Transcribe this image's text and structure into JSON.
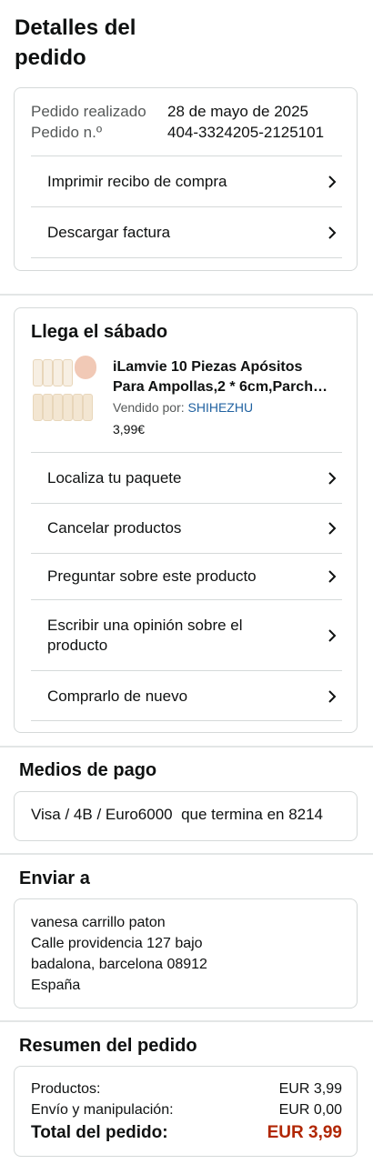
{
  "page": {
    "title": "Detalles del pedido"
  },
  "order": {
    "placed_label": "Pedido realizado",
    "placed_value": "28 de mayo de 2025",
    "number_label": "Pedido n.º",
    "number_value": "404-3324205-2125101",
    "actions": [
      {
        "label": "Imprimir recibo de compra"
      },
      {
        "label": "Descargar factura"
      }
    ]
  },
  "shipment": {
    "heading": "Llega el sábado",
    "product": {
      "title_line1": "iLamvie 10 Piezas Apósitos",
      "title_line2": "Para Ampollas,2 * 6cm,Parch…",
      "seller_label": "Vendido por:",
      "seller_name": "SHIHEZHU",
      "price": "3,99€"
    },
    "actions": [
      {
        "label": "Localiza tu paquete"
      },
      {
        "label": "Cancelar productos"
      },
      {
        "label": "Preguntar sobre este producto"
      },
      {
        "label_line1": "Escribir una opinión sobre el",
        "label_line2": "producto"
      },
      {
        "label": "Comprarlo de nuevo"
      }
    ]
  },
  "payment": {
    "heading": "Medios de pago",
    "method": "Visa / 4B / Euro6000  que termina en 8214"
  },
  "shipping": {
    "heading": "Enviar a",
    "lines": [
      "vanesa carrillo paton",
      "Calle providencia 127 bajo",
      "badalona, barcelona 08912",
      "España"
    ]
  },
  "summary": {
    "heading": "Resumen del pedido",
    "products_label": "Productos:",
    "products_value": "EUR 3,99",
    "shipping_label": "Envío y manipulación:",
    "shipping_value": "EUR 0,00",
    "total_label": "Total del pedido:",
    "total_value": "EUR 3,99"
  },
  "colors": {
    "link": "#2162a1",
    "total": "#b12704",
    "border": "#d5d9d9"
  },
  "icons": {
    "row_chevron": "chevron-right-icon"
  }
}
